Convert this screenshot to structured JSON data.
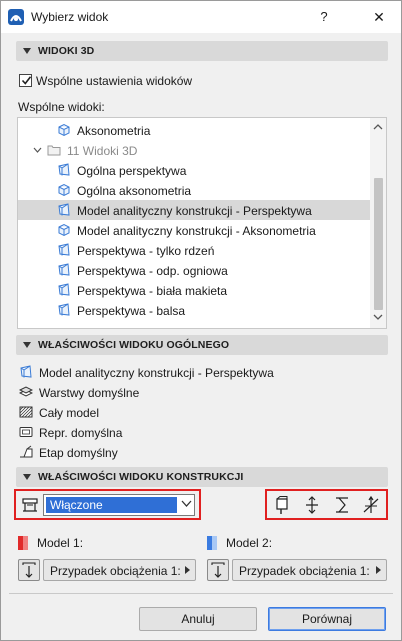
{
  "window": {
    "title": "Wybierz widok",
    "help_label": "?",
    "close_label": "✕"
  },
  "sections": {
    "views_3d": "WIDOKI 3D",
    "general_props": "WŁAŚCIWOŚCI WIDOKU OGÓLNEGO",
    "structural_props": "WŁAŚCIWOŚCI WIDOKU KONSTRUKCJI"
  },
  "views_3d": {
    "shared_settings_label": "Wspólne ustawienia widoków",
    "shared_settings_checked": true,
    "shared_views_label": "Wspólne widoki:",
    "tree": [
      {
        "label": "Aksonometria",
        "icon": "cube-icon",
        "dim": false,
        "selected": false
      },
      {
        "label": "11 Widoki 3D",
        "icon": "folder-icon",
        "dim": true,
        "selected": false
      },
      {
        "label": "Ogólna perspektywa",
        "icon": "perspective-cube-icon",
        "dim": false,
        "selected": false
      },
      {
        "label": "Ogólna aksonometria",
        "icon": "cube-icon",
        "dim": false,
        "selected": false
      },
      {
        "label": "Model analityczny konstrukcji - Perspektywa",
        "icon": "perspective-cube-icon",
        "dim": false,
        "selected": true
      },
      {
        "label": "Model analityczny konstrukcji - Aksonometria",
        "icon": "cube-icon",
        "dim": false,
        "selected": false
      },
      {
        "label": "Perspektywa - tylko rdzeń",
        "icon": "perspective-cube-icon",
        "dim": false,
        "selected": false
      },
      {
        "label": "Perspektywa - odp. ogniowa",
        "icon": "perspective-cube-icon",
        "dim": false,
        "selected": false
      },
      {
        "label": "Perspektywa - biała makieta",
        "icon": "perspective-cube-icon",
        "dim": false,
        "selected": false
      },
      {
        "label": "Perspektywa - balsa",
        "icon": "perspective-cube-icon",
        "dim": false,
        "selected": false
      }
    ]
  },
  "general_props": [
    {
      "label": "Model analityczny konstrukcji - Perspektywa",
      "icon": "perspective-cube-icon"
    },
    {
      "label": "Warstwy domyślne",
      "icon": "layers-icon"
    },
    {
      "label": "Cały model",
      "icon": "hatch-icon"
    },
    {
      "label": "Repr. domyślna",
      "icon": "display-icon"
    },
    {
      "label": "Etap domyślny",
      "icon": "phase-icon"
    }
  ],
  "structural": {
    "display_value": "Włączone",
    "model1_label": "Model 1:",
    "model2_label": "Model 2:",
    "model1_color_a": "#e02a2a",
    "model1_color_b": "#f08080",
    "model2_color_a": "#3a7be0",
    "model2_color_b": "#a8c8f5",
    "load_case_1": "Przypadek obciążenia 1:",
    "load_case_2": "Przypadek obciążenia 1:"
  },
  "buttons": {
    "cancel": "Anuluj",
    "compare": "Porównaj"
  }
}
